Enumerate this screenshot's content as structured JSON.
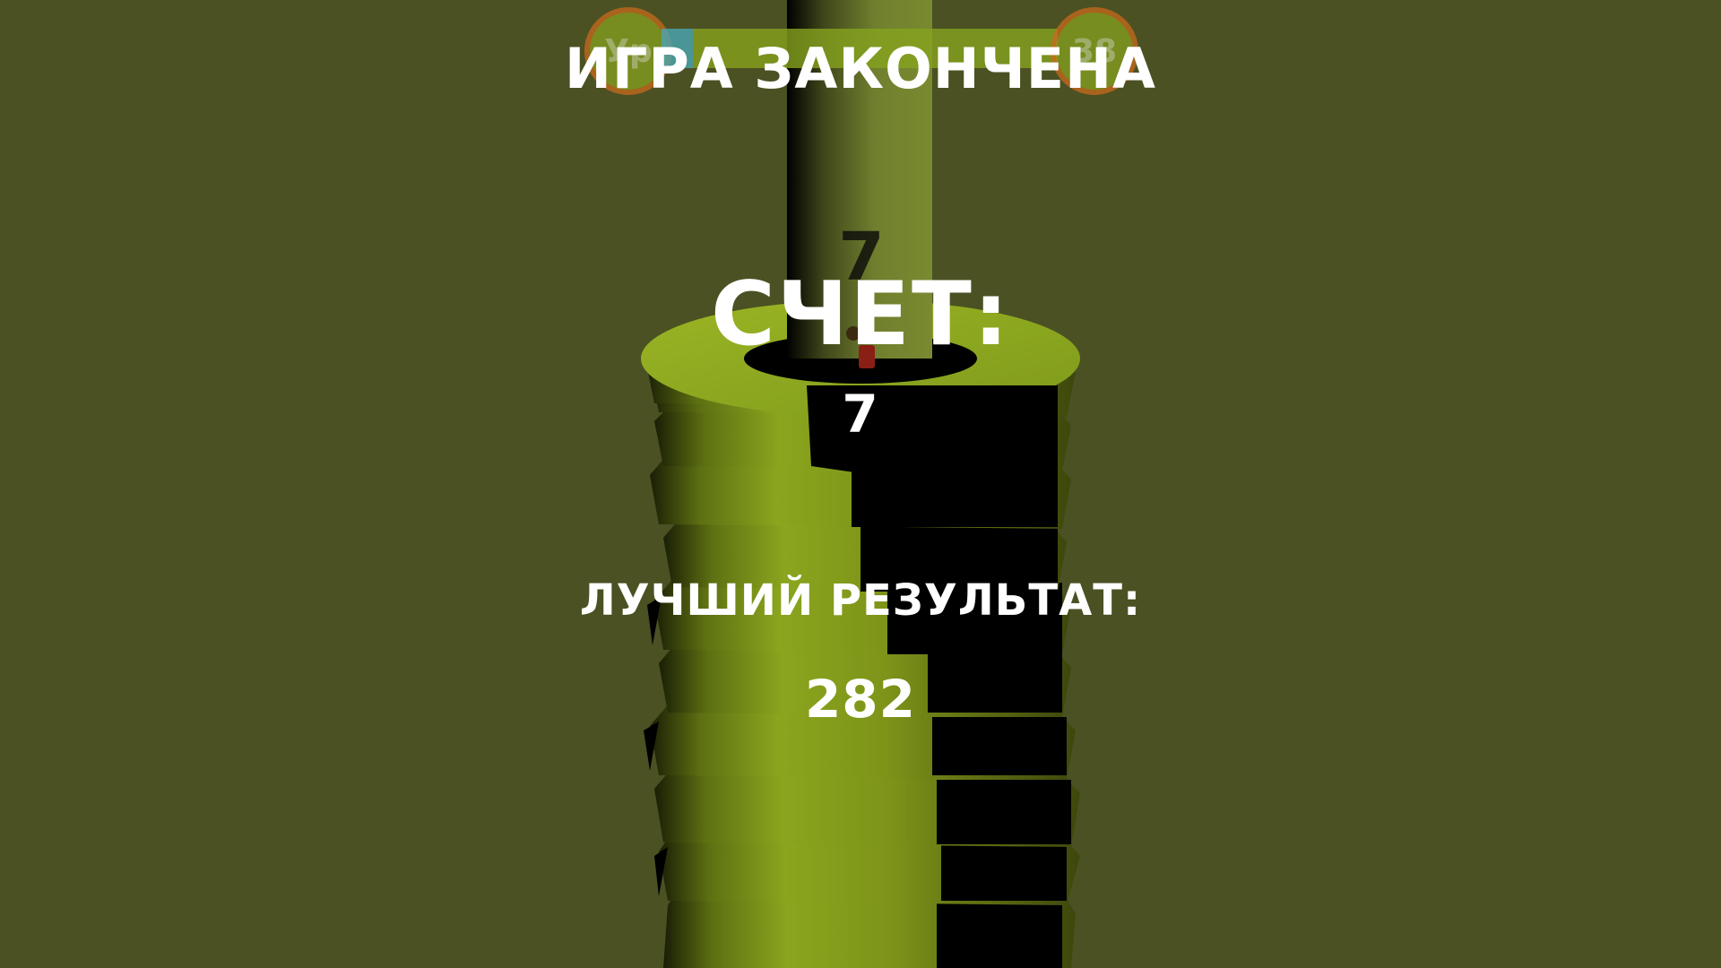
{
  "hud": {
    "current_level": "Ур",
    "next_level": "38",
    "progress_fraction": 0.08,
    "colors": {
      "background": "#4b5123",
      "tower_green": "#8aa51e",
      "tower_dark": "#000000",
      "level_ring": "#c96a1c",
      "progress_fill": "#4aa6b2"
    }
  },
  "tower": {
    "floating_score": "7"
  },
  "game_over": {
    "title": "ИГРА ЗАКОНЧЕНА",
    "score_label": "СЧЕТ:",
    "score_value": "7",
    "best_label": "ЛУЧШИЙ РЕЗУЛЬТАТ:",
    "best_value": "282"
  }
}
